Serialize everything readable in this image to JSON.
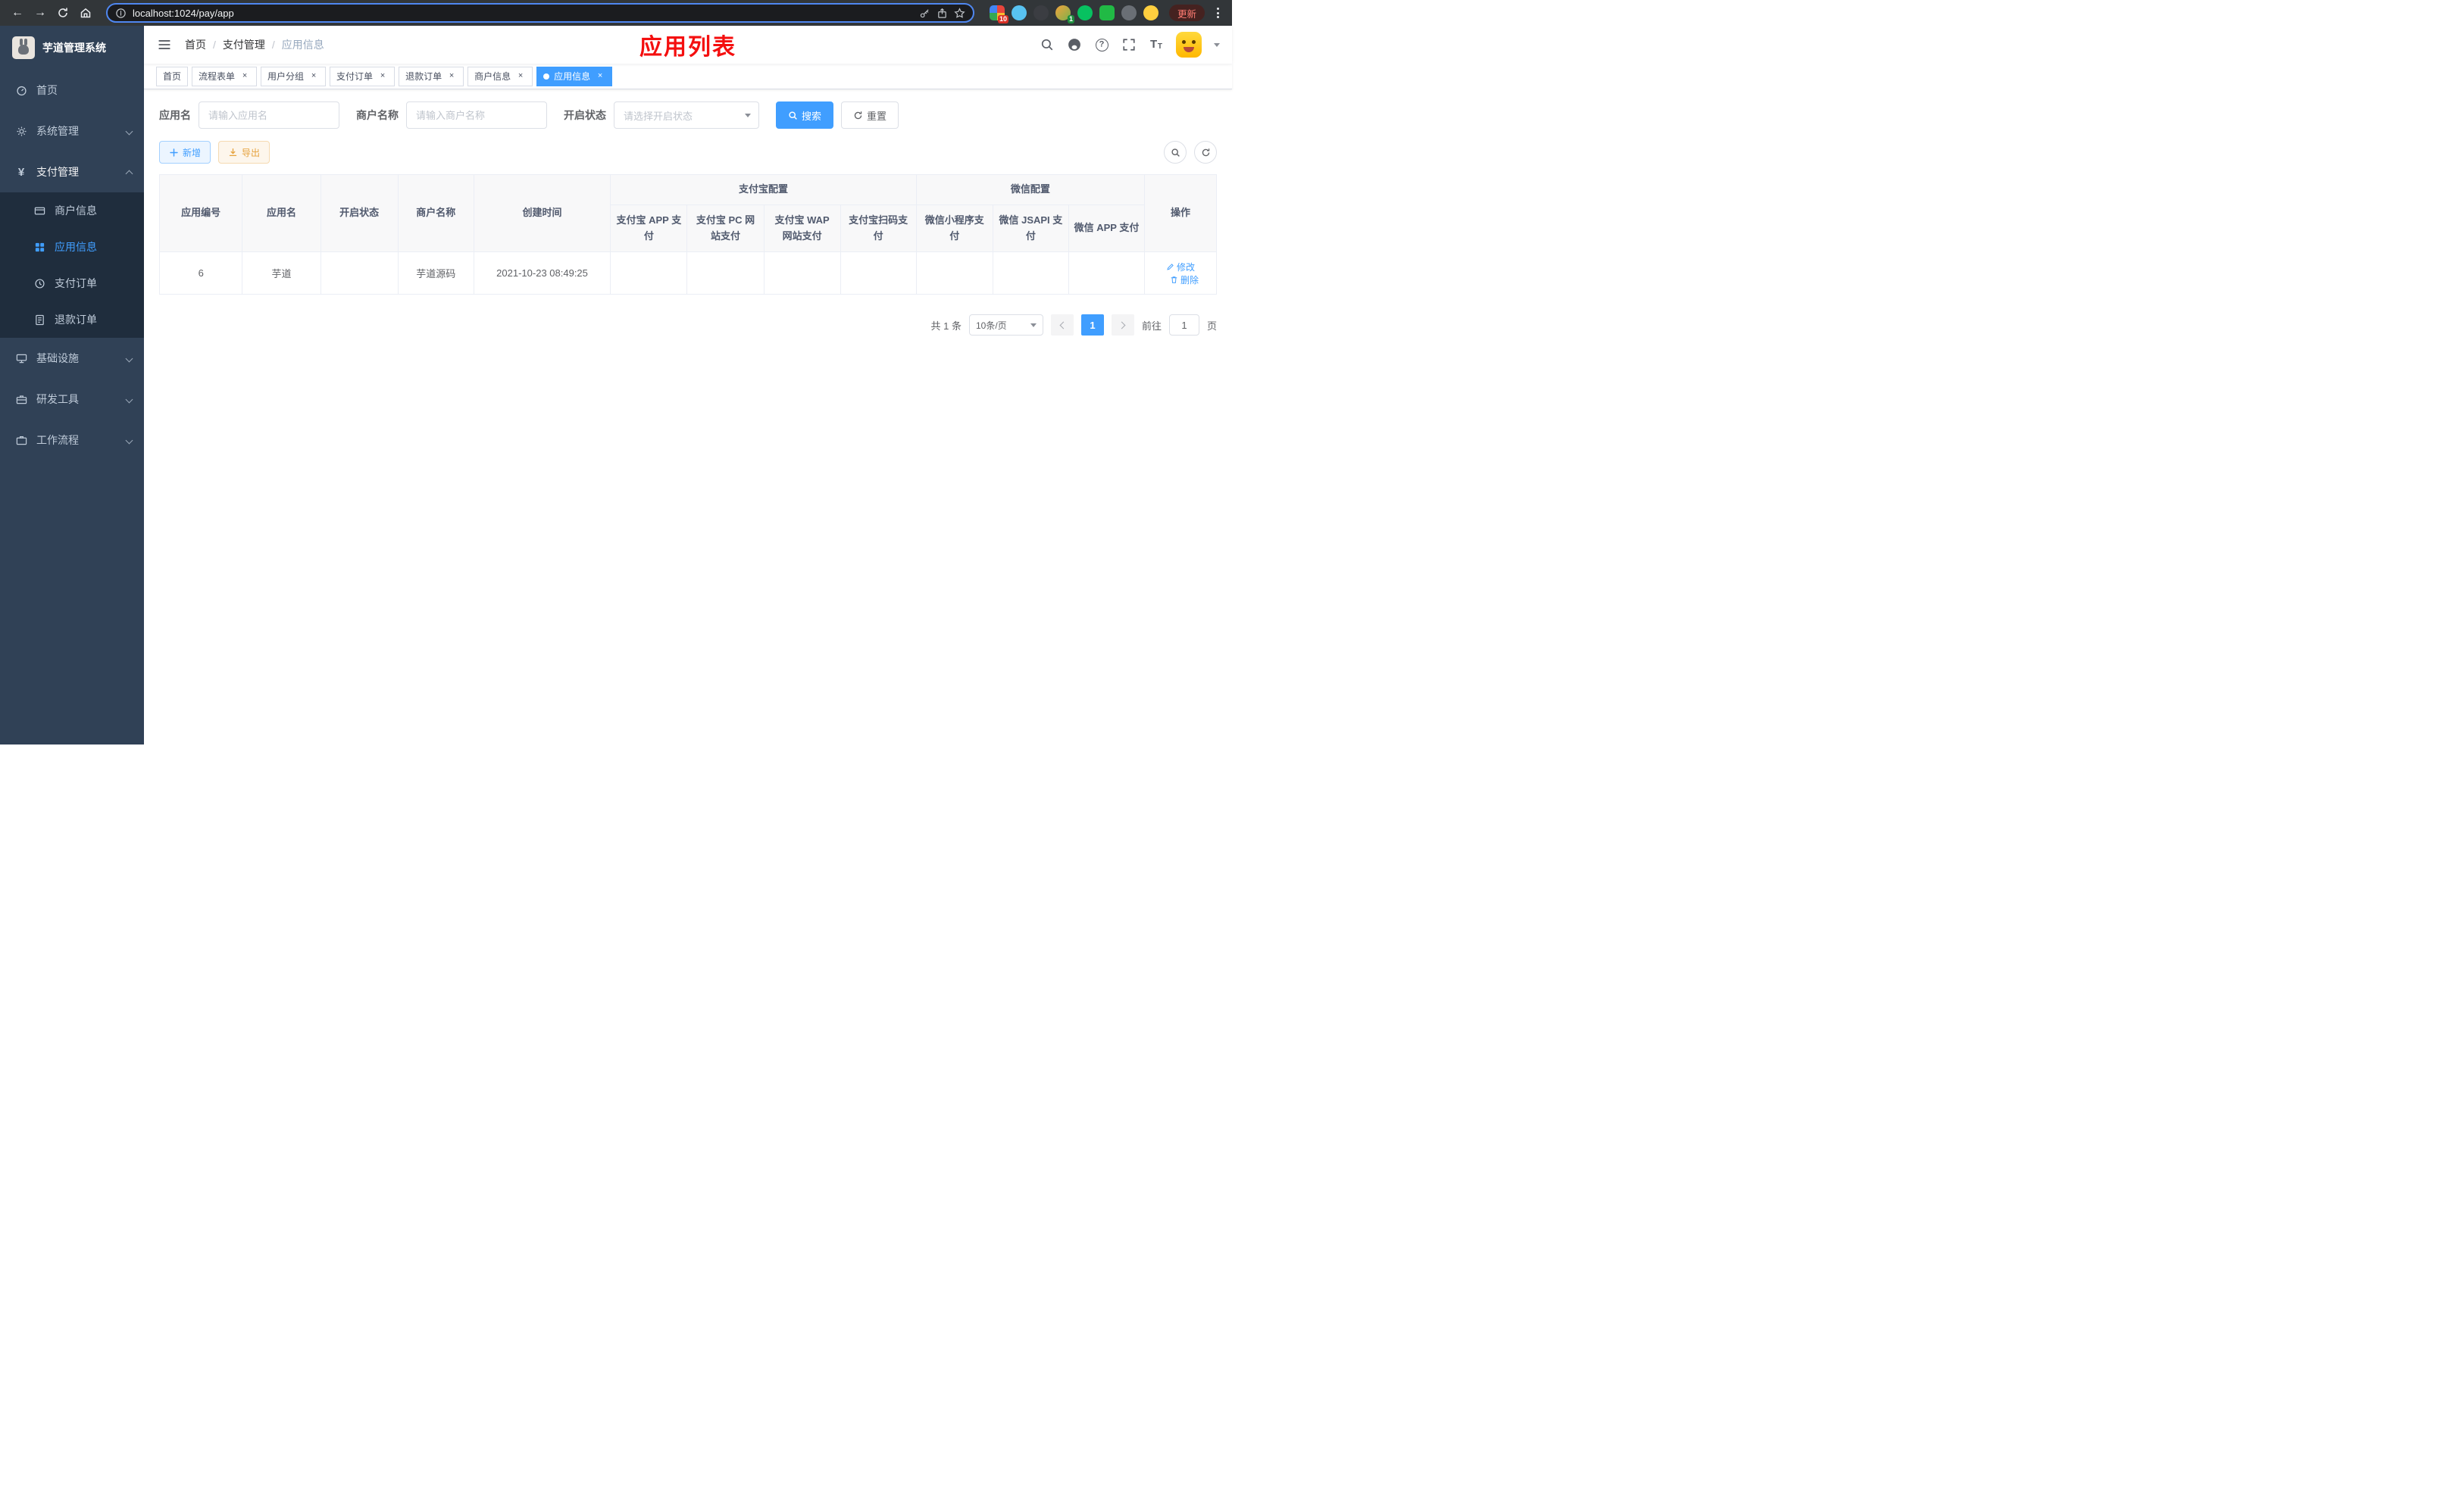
{
  "colors": {
    "primary": "#409eff",
    "title-red": "#f40f0f",
    "circle-no": "#f94b4b",
    "circle-yes": "#1fc05c",
    "sidebar-bg": "#304156",
    "submenu-bg": "#1f2d3d",
    "warning": "#e6a23c",
    "chrome-bg": "#323639",
    "pill-border": "#4f87f0"
  },
  "browser": {
    "url": "localhost:1024/pay/app",
    "update_label": "更新",
    "ext_badge_red": "10",
    "ext_badge_green": "1"
  },
  "sidebar": {
    "title": "芋道管理系统",
    "menu": [
      {
        "label": "首页",
        "icon": "dashboard-icon"
      },
      {
        "label": "系统管理",
        "icon": "gear-icon"
      },
      {
        "label": "支付管理",
        "icon": "yen-icon",
        "expanded": true,
        "children": [
          {
            "label": "商户信息",
            "icon": "card-icon"
          },
          {
            "label": "应用信息",
            "icon": "grid-icon",
            "active": true
          },
          {
            "label": "支付订单",
            "icon": "order-icon"
          },
          {
            "label": "退款订单",
            "icon": "refund-icon"
          }
        ]
      },
      {
        "label": "基础设施",
        "icon": "infra-icon"
      },
      {
        "label": "研发工具",
        "icon": "tools-icon"
      },
      {
        "label": "工作流程",
        "icon": "workflow-icon"
      }
    ]
  },
  "navbar": {
    "breadcrumb": [
      "首页",
      "支付管理",
      "应用信息"
    ],
    "page_title": "应用列表"
  },
  "tabs": [
    {
      "label": "首页"
    },
    {
      "label": "流程表单"
    },
    {
      "label": "用户分组"
    },
    {
      "label": "支付订单"
    },
    {
      "label": "退款订单"
    },
    {
      "label": "商户信息"
    },
    {
      "label": "应用信息",
      "active": true
    }
  ],
  "filters": {
    "app_name_label": "应用名",
    "app_name_placeholder": "请输入应用名",
    "merchant_label": "商户名称",
    "merchant_placeholder": "请输入商户名称",
    "status_label": "开启状态",
    "status_placeholder": "请选择开启状态",
    "search_label": "搜索",
    "reset_label": "重置"
  },
  "toolbar": {
    "add_label": "新增",
    "export_label": "导出"
  },
  "table": {
    "groups": {
      "alipay": "支付宝配置",
      "wechat": "微信配置"
    },
    "columns": {
      "id": "应用编号",
      "name": "应用名",
      "status": "开启状态",
      "merchant": "商户名称",
      "created": "创建时间",
      "alipay": [
        "支付宝 APP 支付",
        "支付宝 PC 网站支付",
        "支付宝 WAP 网站支付",
        "支付宝扫码支付"
      ],
      "wechat": [
        "微信小程序支付",
        "微信 JSAPI 支付",
        "微信 APP 支付"
      ],
      "ops": "操作"
    },
    "row": {
      "id": "6",
      "name": "芋道",
      "enabled": "on",
      "merchant": "芋道源码",
      "created": "2021-10-23 08:49:25",
      "alipay_app": "no",
      "alipay_pc": "no",
      "alipay_wap": "no",
      "alipay_qr": "no",
      "wx_mini": "no",
      "wx_jsapi": "yes",
      "wx_app": "no"
    },
    "ops": {
      "edit": "修改",
      "delete": "删除"
    }
  },
  "pagination": {
    "total": "共 1 条",
    "page_size": "10条/页",
    "current": "1",
    "goto_label": "前往",
    "goto_value": "1",
    "page_word": "页"
  }
}
